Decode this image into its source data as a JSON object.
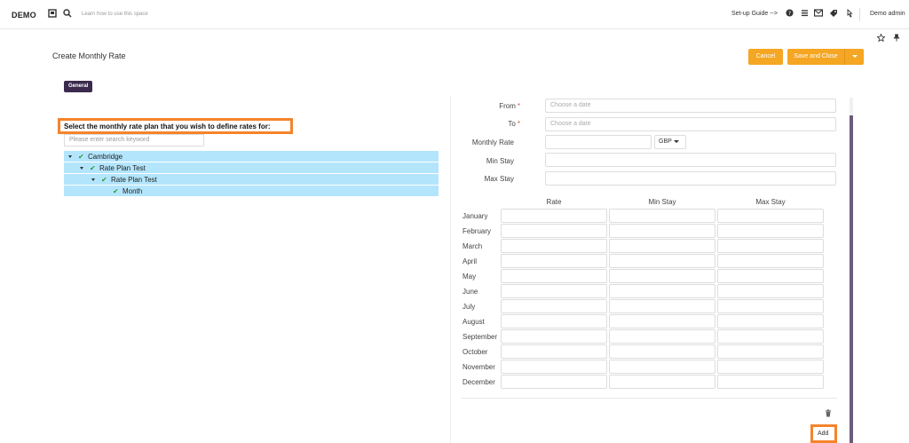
{
  "topbar": {
    "brand": "DEMO",
    "learn": "Learn how to use this space",
    "guide": "Set-up Guide -->",
    "user": "Demo admin",
    "icons": [
      "book-icon",
      "search-icon",
      "help-icon",
      "menu-icon",
      "mail-icon",
      "tag-icon",
      "click-icon",
      "star-icon",
      "pin-icon"
    ]
  },
  "page": {
    "title": "Create Monthly Rate",
    "cancel": "Cancel",
    "save": "Save and Close",
    "tab": "General"
  },
  "plan": {
    "label": "Select the monthly rate plan that you wish to define rates for:",
    "search_placeholder": "Please enter search keyword",
    "tree": [
      {
        "label": "Cambridge",
        "level": 0,
        "expandable": true
      },
      {
        "label": "Rate Plan Test",
        "level": 1,
        "expandable": true
      },
      {
        "label": "Rate Plan Test",
        "level": 2,
        "expandable": true
      },
      {
        "label": "Month",
        "level": 3,
        "expandable": false
      }
    ]
  },
  "form": {
    "from_label": "From",
    "to_label": "To",
    "required_mark": "*",
    "date_placeholder": "Choose a date",
    "monthly_rate_label": "Monthly Rate",
    "currency": "GBP",
    "min_stay_label": "Min Stay",
    "max_stay_label": "Max Stay"
  },
  "grid": {
    "headers": [
      "Rate",
      "Min Stay",
      "Max Stay"
    ],
    "months": [
      "January",
      "February",
      "March",
      "April",
      "May",
      "June",
      "July",
      "August",
      "September",
      "October",
      "November",
      "December"
    ]
  },
  "actions": {
    "add": "Add"
  },
  "colors": {
    "accent": "#f5a623",
    "highlight": "#f5842b",
    "tree_bg": "#b3e5fc",
    "tab_bg": "#3b2a4d"
  }
}
